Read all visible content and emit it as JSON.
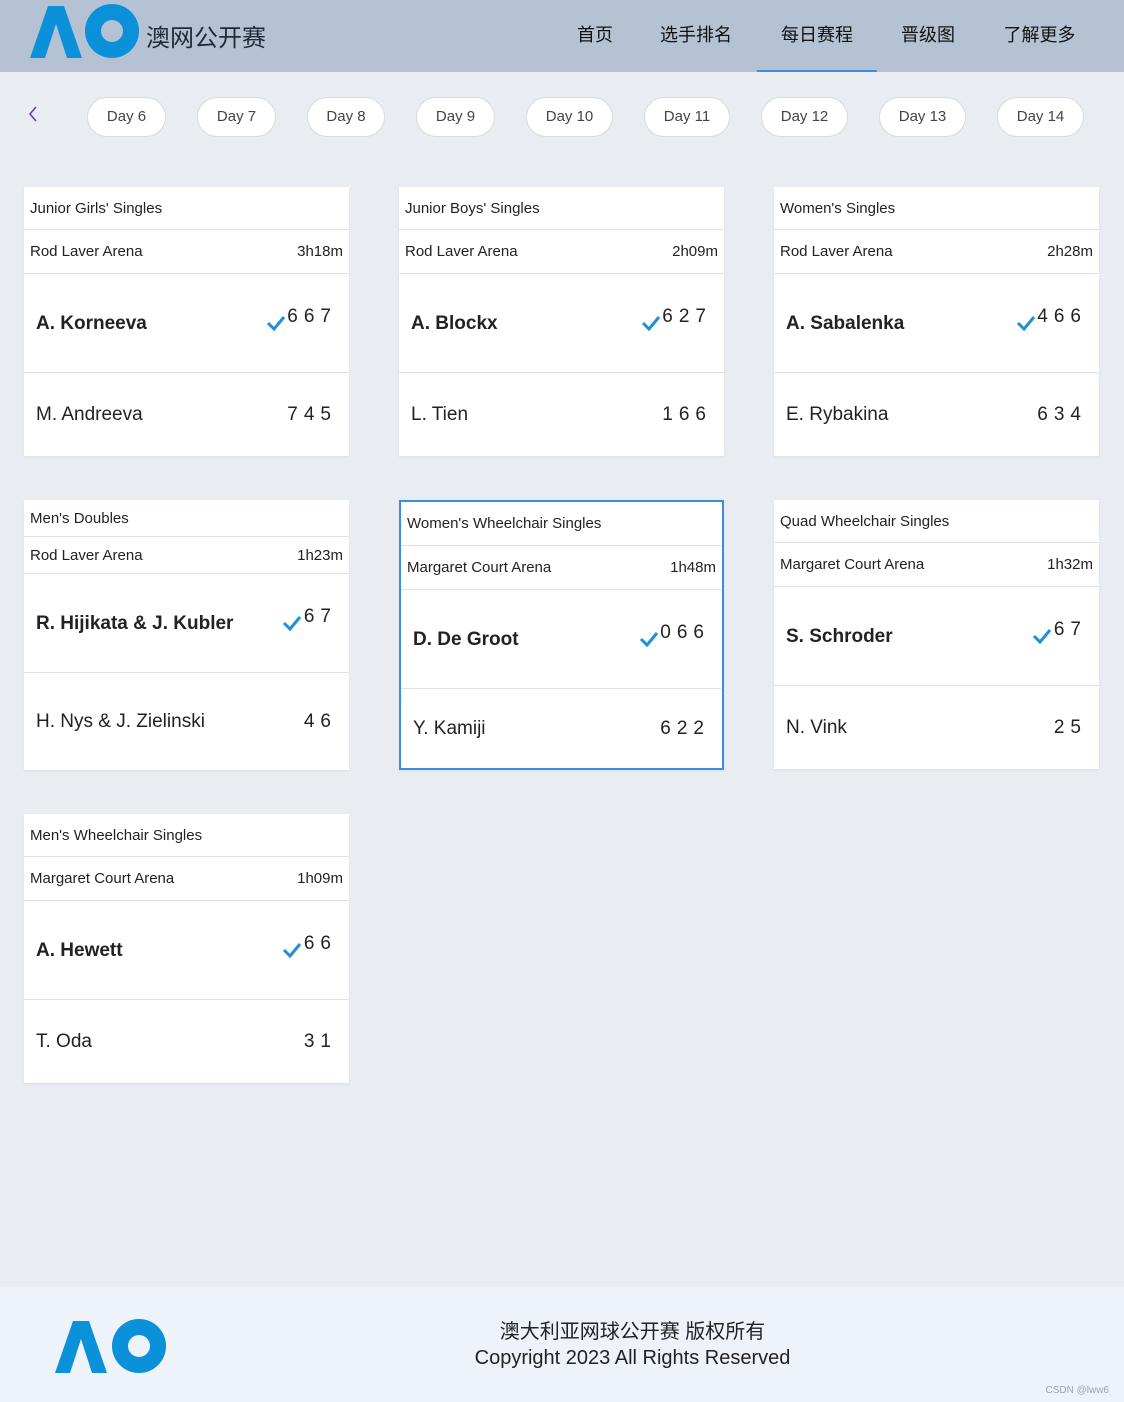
{
  "header": {
    "site_name": "澳网公开赛",
    "nav": [
      {
        "label": "首页"
      },
      {
        "label": "选手排名"
      },
      {
        "label": "每日赛程"
      },
      {
        "label": "晋级图"
      },
      {
        "label": "了解更多"
      }
    ],
    "active_nav": "每日赛程"
  },
  "days": [
    "Day 6",
    "Day 7",
    "Day 8",
    "Day 9",
    "Day 10",
    "Day 11",
    "Day 12",
    "Day 13",
    "Day 14"
  ],
  "matches": [
    {
      "event": "Junior Girls' Singles",
      "court": "Rod Laver Arena",
      "duration": "3h18m",
      "winner": {
        "name": "A. Korneeva",
        "scores": "667"
      },
      "loser": {
        "name": "M. Andreeva",
        "scores": "745"
      }
    },
    {
      "event": "Junior Boys' Singles",
      "court": "Rod Laver Arena",
      "duration": "2h09m",
      "winner": {
        "name": "A. Blockx",
        "scores": "627"
      },
      "loser": {
        "name": "L. Tien",
        "scores": "166"
      }
    },
    {
      "event": "Women's Singles",
      "court": "Rod Laver Arena",
      "duration": "2h28m",
      "winner": {
        "name": "A. Sabalenka",
        "scores": "466"
      },
      "loser": {
        "name": "E. Rybakina",
        "scores": "634"
      }
    },
    {
      "event": "Men's Doubles",
      "court": "Rod Laver Arena",
      "duration": "1h23m",
      "winner": {
        "name": "R. Hijikata & J. Kubler",
        "scores": "67"
      },
      "loser": {
        "name": "H. Nys & J. Zielinski",
        "scores": "46"
      }
    },
    {
      "event": "Women's Wheelchair Singles",
      "court": "Margaret Court Arena",
      "duration": "1h48m",
      "winner": {
        "name": "D. De Groot",
        "scores": "066"
      },
      "loser": {
        "name": "Y. Kamiji",
        "scores": "622"
      }
    },
    {
      "event": "Quad Wheelchair Singles",
      "court": "Margaret Court Arena",
      "duration": "1h32m",
      "winner": {
        "name": "S. Schroder",
        "scores": "67"
      },
      "loser": {
        "name": "N. Vink",
        "scores": "25"
      }
    },
    {
      "event": "Men's Wheelchair Singles",
      "court": "Margaret Court Arena",
      "duration": "1h09m",
      "winner": {
        "name": "A. Hewett",
        "scores": "66"
      },
      "loser": {
        "name": "T. Oda",
        "scores": "31"
      }
    }
  ],
  "selected_match": "Women's Wheelchair Singles",
  "footer": {
    "line1": "澳大利亚网球公开赛 版权所有",
    "line2": "Copyright 2023 All Rights Reserved"
  },
  "watermark": "CSDN @lww6",
  "colors": {
    "header_bg": "#b4c2d3",
    "logo_blue": "#0a91d9",
    "accent": "#3a8ee6",
    "page_bg": "#e9edf2"
  }
}
